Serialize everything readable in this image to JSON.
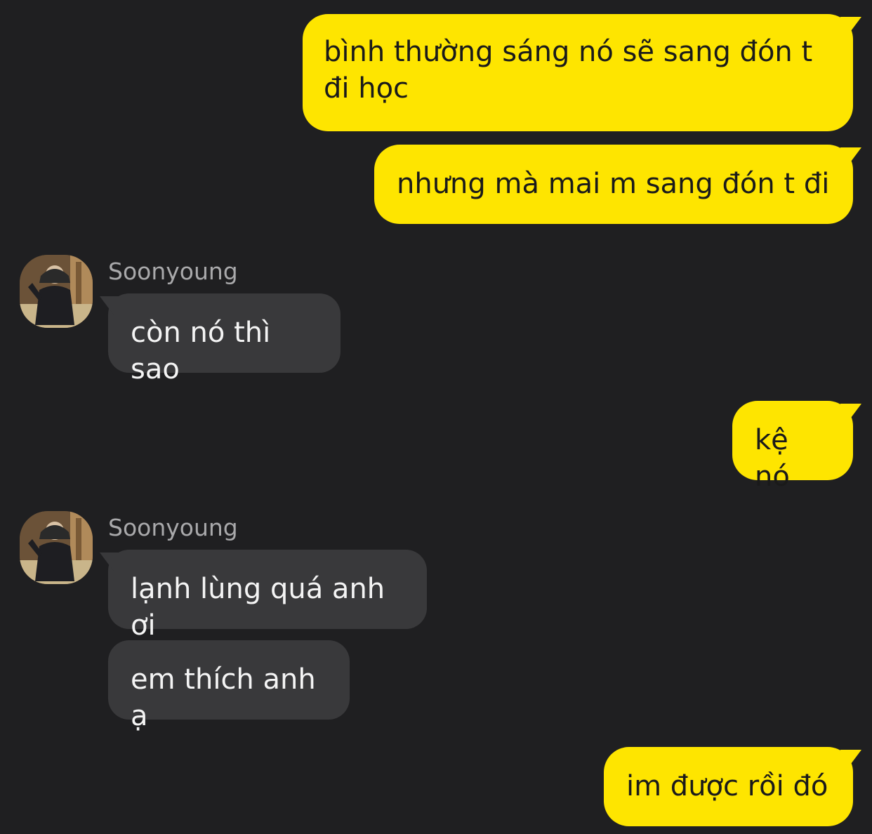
{
  "messages": [
    {
      "text": "bình thường sáng nó sẽ sang đón t đi học"
    },
    {
      "text": "nhưng mà mai m sang đón t đi"
    },
    {
      "sender": "Soonyoung",
      "text": "còn nó thì sao"
    },
    {
      "text": "kệ nó"
    },
    {
      "sender": "Soonyoung",
      "text": "lạnh lùng quá anh ơi"
    },
    {
      "text": "em thích anh ạ"
    },
    {
      "text": "im được rồi đó"
    }
  ],
  "colors": {
    "background": "#1f1f21",
    "outgoing_bubble": "#fee500",
    "incoming_bubble": "#39393b"
  }
}
